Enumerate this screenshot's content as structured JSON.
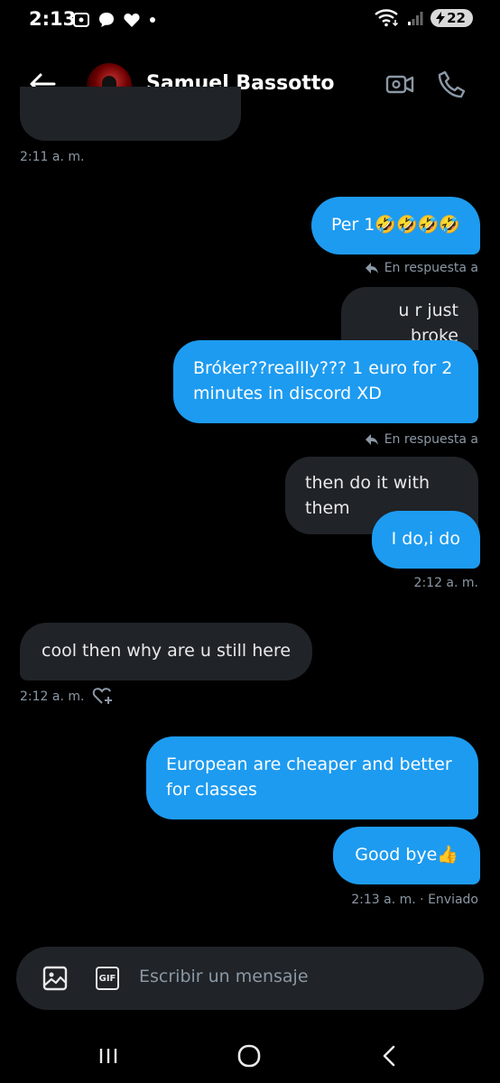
{
  "status_bar": {
    "time": "2:13",
    "battery": "22"
  },
  "header": {
    "contact_name": "Samuel Bassotto"
  },
  "messages": [
    {
      "side": "received",
      "kind": "partial"
    },
    {
      "side": "meta",
      "text": "2:11 a. m."
    },
    {
      "side": "sent",
      "text": "Per 1🤣🤣🤣🤣"
    },
    {
      "side": "reply_indicator",
      "text": "En respuesta a"
    },
    {
      "side": "received",
      "text": "u r just broke"
    },
    {
      "side": "sent",
      "text": "Bróker??reallly??? 1 euro for 2 minutes in discord XD"
    },
    {
      "side": "reply_indicator",
      "text": "En respuesta a"
    },
    {
      "side": "received",
      "text": "then do it with them"
    },
    {
      "side": "sent",
      "text": "I do,i do"
    },
    {
      "side": "meta",
      "text": "2:12 a. m."
    },
    {
      "side": "received",
      "text": "cool then why are u still here"
    },
    {
      "side": "meta",
      "text": "2:12 a. m."
    },
    {
      "side": "sent",
      "text": "European are cheaper and better for classes"
    },
    {
      "side": "sent",
      "text": "Good bye👍"
    },
    {
      "side": "meta",
      "text": "2:13 a. m. · Enviado"
    }
  ],
  "composer": {
    "placeholder": "Escribir un mensaje",
    "gif_label": "GIF"
  },
  "colors": {
    "accent": "#1d9bf0",
    "received_bubble": "#202327",
    "background": "#000000",
    "meta": "#8b98a5"
  },
  "icons": [
    "back-arrow-icon",
    "video-call-icon",
    "phone-icon",
    "image-icon",
    "gif-icon",
    "voice-icon",
    "like-add-icon",
    "reply-icon"
  ]
}
